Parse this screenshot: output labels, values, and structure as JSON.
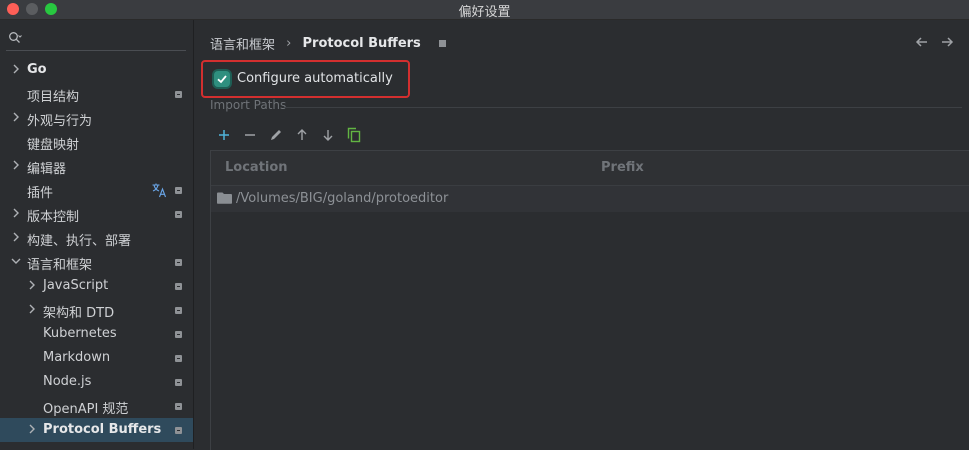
{
  "window": {
    "title": "偏好设置"
  },
  "search": {
    "placeholder": ""
  },
  "sidebar": {
    "items": [
      {
        "label": "Go",
        "expandable": true,
        "bold": true,
        "badge": false
      },
      {
        "label": "项目结构",
        "expandable": false,
        "badge": true
      },
      {
        "label": "外观与行为",
        "expandable": true,
        "badge": false
      },
      {
        "label": "键盘映射",
        "expandable": false,
        "badge": false
      },
      {
        "label": "编辑器",
        "expandable": true,
        "badge": false
      },
      {
        "label": "插件",
        "expandable": false,
        "badge": true,
        "translate": true
      },
      {
        "label": "版本控制",
        "expandable": true,
        "badge": true
      },
      {
        "label": "构建、执行、部署",
        "expandable": true,
        "badge": false
      },
      {
        "label": "语言和框架",
        "expanded": true,
        "badge": true
      },
      {
        "label": "JavaScript",
        "expandable": true,
        "badge": true
      },
      {
        "label": "架构和 DTD",
        "expandable": true,
        "badge": true
      },
      {
        "label": "Kubernetes",
        "badge": true
      },
      {
        "label": "Markdown",
        "badge": true
      },
      {
        "label": "Node.js",
        "badge": true
      },
      {
        "label": "OpenAPI 规范",
        "badge": true
      },
      {
        "label": "Protocol Buffers",
        "expandable": true,
        "selected": true,
        "badge": true
      }
    ]
  },
  "breadcrumb": {
    "parent": "语言和框架",
    "separator": "›",
    "current": "Protocol Buffers"
  },
  "settings": {
    "configure_auto_label": "Configure automatically",
    "configure_auto_checked": true,
    "import_paths_title": "Import Paths"
  },
  "toolbar": {
    "icons": [
      "add-icon",
      "remove-icon",
      "edit-icon",
      "move-up-icon",
      "move-down-icon",
      "copy-icon"
    ]
  },
  "table": {
    "columns": [
      "Location",
      "Prefix"
    ],
    "rows": [
      {
        "location": "/Volumes/BIG/goland/protoeditor",
        "prefix": ""
      }
    ]
  },
  "colors": {
    "accent": "#2f8f7f",
    "highlight_border": "#d32f2f",
    "selection": "#2f4a5c",
    "background": "#2b2d30"
  }
}
